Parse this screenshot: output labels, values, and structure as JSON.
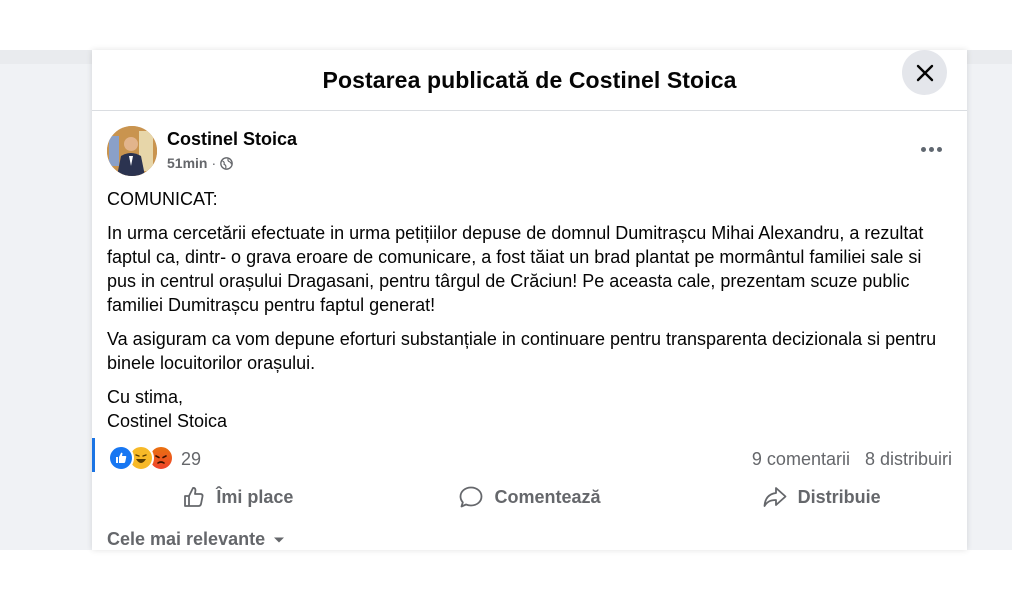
{
  "modal": {
    "title": "Postarea publicată de Costinel Stoica"
  },
  "post": {
    "author": "Costinel Stoica",
    "time": "51min",
    "separator": "·",
    "privacy_icon": "globe-icon",
    "paragraphs": [
      "COMUNICAT:",
      "In urma cercetării efectuate in urma petițiilor depuse de domnul Dumitrașcu Mihai Alexandru, a rezultat faptul ca, dintr- o grava eroare de comunicare, a fost tăiat un brad plantat pe mormântul familiei sale si pus in centrul orașului Dragasani, pentru târgul de Crăciun! Pe aceasta cale, prezentam scuze public familiei Dumitrașcu pentru faptul generat!",
      "Va asiguram  ca vom depune eforturi substanțiale in continuare pentru transparenta decizionala si pentru binele locuitorilor orașului.",
      "Cu stima,\nCostinel Stoica"
    ]
  },
  "reactions": {
    "icons": [
      "like",
      "haha",
      "angry"
    ],
    "count": "29",
    "comments": "9 comentarii",
    "shares": "8 distribuiri"
  },
  "actions": {
    "like": "Îmi place",
    "comment": "Comentează",
    "share": "Distribuie"
  },
  "comments_sort": {
    "label": "Cele mai relevante"
  },
  "colors": {
    "accent": "#1877f2",
    "text_secondary": "#65676b",
    "close_bg": "#e4e6eb"
  }
}
